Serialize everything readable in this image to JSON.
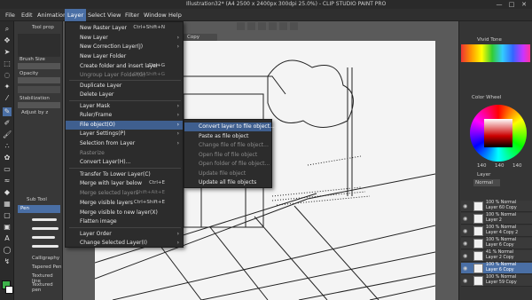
{
  "window": {
    "title": "Illustration32* (A4 2500 x 2400px 300dpi 25.0%) - CLIP STUDIO PAINT PRO",
    "controls": [
      "—",
      "□",
      "✕"
    ]
  },
  "menubar": {
    "items": [
      "File",
      "Edit",
      "Animation",
      "Layer",
      "Select",
      "View",
      "Filter",
      "Window",
      "Help"
    ]
  },
  "layer_menu": {
    "items": [
      {
        "label": "New Raster Layer",
        "shortcut": "Ctrl+Shift+N",
        "disabled": false,
        "submenu": false
      },
      {
        "label": "New Layer",
        "shortcut": "",
        "disabled": false,
        "submenu": true
      },
      {
        "label": "New Correction Layer(J)",
        "shortcut": "",
        "disabled": false,
        "submenu": true
      },
      {
        "label": "New Layer Folder",
        "shortcut": "",
        "disabled": false,
        "submenu": false
      },
      {
        "label": "Create folder and insert layer",
        "shortcut": "Ctrl+G",
        "disabled": false,
        "submenu": false
      },
      {
        "label": "Ungroup Layer Folder(G)",
        "shortcut": "Ctrl+Shift+G",
        "disabled": true,
        "submenu": false
      },
      {
        "label": "Duplicate Layer",
        "shortcut": "",
        "disabled": false,
        "submenu": false
      },
      {
        "label": "Delete Layer",
        "shortcut": "",
        "disabled": false,
        "submenu": false
      },
      {
        "label": "Layer Mask",
        "shortcut": "",
        "disabled": false,
        "submenu": true
      },
      {
        "label": "Ruler/Frame",
        "shortcut": "",
        "disabled": false,
        "submenu": true
      },
      {
        "label": "File object(O)",
        "shortcut": "",
        "disabled": false,
        "submenu": true
      },
      {
        "label": "Layer Settings(P)",
        "shortcut": "",
        "disabled": false,
        "submenu": true
      },
      {
        "label": "Selection from Layer",
        "shortcut": "",
        "disabled": false,
        "submenu": true
      },
      {
        "label": "Rasterize",
        "shortcut": "",
        "disabled": true,
        "submenu": false
      },
      {
        "label": "Convert Layer(H)...",
        "shortcut": "",
        "disabled": false,
        "submenu": false
      },
      {
        "label": "Transfer To Lower Layer(C)",
        "shortcut": "",
        "disabled": false,
        "submenu": false
      },
      {
        "label": "Merge with layer below",
        "shortcut": "Ctrl+E",
        "disabled": false,
        "submenu": false
      },
      {
        "label": "Merge selected layers",
        "shortcut": "Shift+Alt+E",
        "disabled": true,
        "submenu": false
      },
      {
        "label": "Merge visible layers",
        "shortcut": "Ctrl+Shift+E",
        "disabled": false,
        "submenu": false
      },
      {
        "label": "Merge visible to new layer(X)",
        "shortcut": "",
        "disabled": false,
        "submenu": false
      },
      {
        "label": "Flatten image",
        "shortcut": "",
        "disabled": false,
        "submenu": false
      },
      {
        "label": "Layer Order",
        "shortcut": "",
        "disabled": false,
        "submenu": true
      },
      {
        "label": "Change Selected Layer(I)",
        "shortcut": "",
        "disabled": false,
        "submenu": true
      }
    ],
    "highlighted": "File object(O)"
  },
  "file_object_submenu": {
    "items": [
      {
        "label": "Convert layer to file object...",
        "disabled": false
      },
      {
        "label": "Paste as file object",
        "disabled": false
      },
      {
        "label": "Change file of file object...",
        "disabled": true
      },
      {
        "label": "Open file of file object",
        "disabled": true
      },
      {
        "label": "Open folder of file object...",
        "disabled": true
      },
      {
        "label": "Update file object",
        "disabled": true
      },
      {
        "label": "Update all file objects",
        "disabled": false
      }
    ]
  },
  "left_panel": {
    "tool_property_title": "Tool prop",
    "brush_size_label": "Brush Size",
    "opacity_label": "Opacity",
    "stabilization_label": "Stabilization",
    "adjust_label": "Adjust by z",
    "sub_tool_title": "Sub Tool",
    "pen_label": "Pen",
    "brushes": [
      "Calligraphy",
      "Tapered Pen",
      "Textured line",
      "Textured pen"
    ]
  },
  "canvas_tab": "Copy",
  "right_panel": {
    "color_title": "Color Wheel",
    "vivid_title": "Vivid Tone",
    "color_values": [
      "140",
      "140",
      "140"
    ],
    "layer_title": "Layer",
    "blend_mode": "Normal",
    "layers": [
      {
        "name": "100 % Normal\nLayer 60 Copy",
        "selected": false
      },
      {
        "name": "100 % Normal\nLayer 2",
        "selected": false
      },
      {
        "name": "100 % Normal\nLayer 4 Copy 2",
        "selected": false
      },
      {
        "name": "100 % Normal\nLayer 6 Copy",
        "selected": false
      },
      {
        "name": "41 % Normal\nLayer 2 Copy",
        "selected": false
      },
      {
        "name": "100 % Normal\nLayer 6 Copy",
        "selected": true
      },
      {
        "name": "100 % Normal\nLayer 59 Copy",
        "selected": false
      }
    ]
  }
}
